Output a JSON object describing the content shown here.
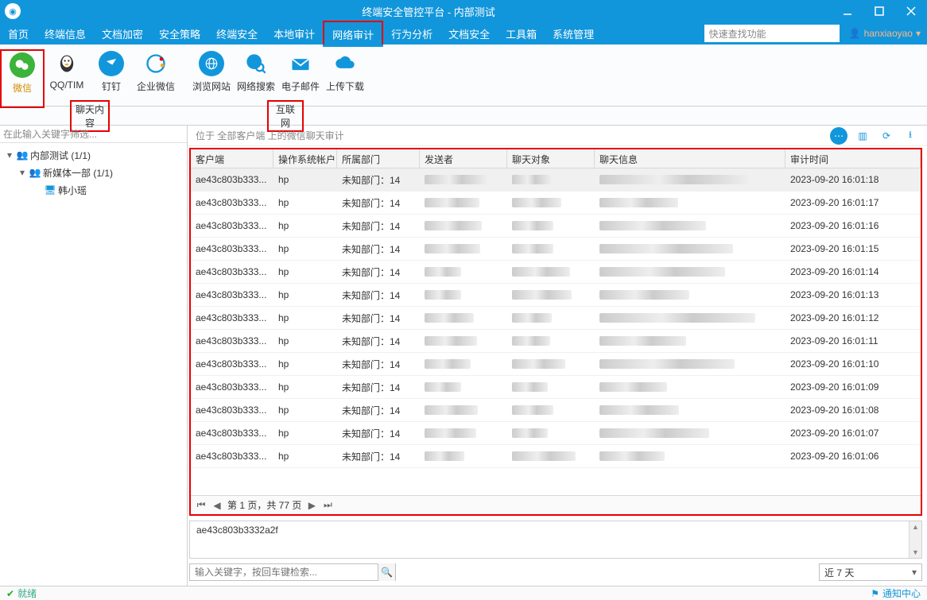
{
  "window": {
    "title": "终端安全管控平台 - 内部测试"
  },
  "menu": {
    "items": [
      "首页",
      "终端信息",
      "文档加密",
      "安全策略",
      "终端安全",
      "本地审计",
      "网络审计",
      "行为分析",
      "文档安全",
      "工具箱",
      "系统管理"
    ],
    "highlighted_index": 6,
    "search_placeholder": "快速查找功能",
    "user": "hanxiaoyao"
  },
  "ribbon": {
    "chat_group_label": "聊天内容",
    "net_group_label": "互联网",
    "buttons": [
      {
        "id": "wechat",
        "label": "微信"
      },
      {
        "id": "qq",
        "label": "QQ/TIM"
      },
      {
        "id": "dingtalk",
        "label": "钉钉"
      },
      {
        "id": "workwx",
        "label": "企业微信"
      },
      {
        "id": "browse",
        "label": "浏览网站"
      },
      {
        "id": "websearch",
        "label": "网络搜索"
      },
      {
        "id": "email",
        "label": "电子邮件"
      },
      {
        "id": "updown",
        "label": "上传下载"
      }
    ]
  },
  "sidebar": {
    "filter_placeholder": "在此输入关键字筛选...",
    "tree": {
      "root": "内部测试 (1/1)",
      "child1": "新媒体一部 (1/1)",
      "leaf": "韩小瑶"
    }
  },
  "breadcrumb": {
    "text": "位于 全部客户端 上的微信聊天审计"
  },
  "grid": {
    "columns": [
      "客户端",
      "操作系统帐户",
      "所属部门",
      "发送者",
      "聊天对象",
      "聊天信息",
      "审计时间"
    ],
    "rows": [
      {
        "client": "ae43c803b333...",
        "os": "hp",
        "dept": "未知部门：14",
        "time": "2023-09-20 16:01:18"
      },
      {
        "client": "ae43c803b333...",
        "os": "hp",
        "dept": "未知部门：14",
        "time": "2023-09-20 16:01:17"
      },
      {
        "client": "ae43c803b333...",
        "os": "hp",
        "dept": "未知部门：14",
        "time": "2023-09-20 16:01:16"
      },
      {
        "client": "ae43c803b333...",
        "os": "hp",
        "dept": "未知部门：14",
        "time": "2023-09-20 16:01:15"
      },
      {
        "client": "ae43c803b333...",
        "os": "hp",
        "dept": "未知部门：14",
        "time": "2023-09-20 16:01:14"
      },
      {
        "client": "ae43c803b333...",
        "os": "hp",
        "dept": "未知部门：14",
        "time": "2023-09-20 16:01:13"
      },
      {
        "client": "ae43c803b333...",
        "os": "hp",
        "dept": "未知部门：14",
        "time": "2023-09-20 16:01:12"
      },
      {
        "client": "ae43c803b333...",
        "os": "hp",
        "dept": "未知部门：14",
        "time": "2023-09-20 16:01:11"
      },
      {
        "client": "ae43c803b333...",
        "os": "hp",
        "dept": "未知部门：14",
        "time": "2023-09-20 16:01:10"
      },
      {
        "client": "ae43c803b333...",
        "os": "hp",
        "dept": "未知部门：14",
        "time": "2023-09-20 16:01:09"
      },
      {
        "client": "ae43c803b333...",
        "os": "hp",
        "dept": "未知部门：14",
        "time": "2023-09-20 16:01:08"
      },
      {
        "client": "ae43c803b333...",
        "os": "hp",
        "dept": "未知部门：14",
        "time": "2023-09-20 16:01:07"
      },
      {
        "client": "ae43c803b333...",
        "os": "hp",
        "dept": "未知部门：14",
        "time": "2023-09-20 16:01:06"
      }
    ],
    "pager": "第 1 页，共 77 页"
  },
  "detail": {
    "selected_client": "ae43c803b3332a2f"
  },
  "search": {
    "keyword_placeholder": "输入关键字，按回车键检索...",
    "range": "近 7 天"
  },
  "status": {
    "text": "就绪",
    "right": "通知中心"
  }
}
